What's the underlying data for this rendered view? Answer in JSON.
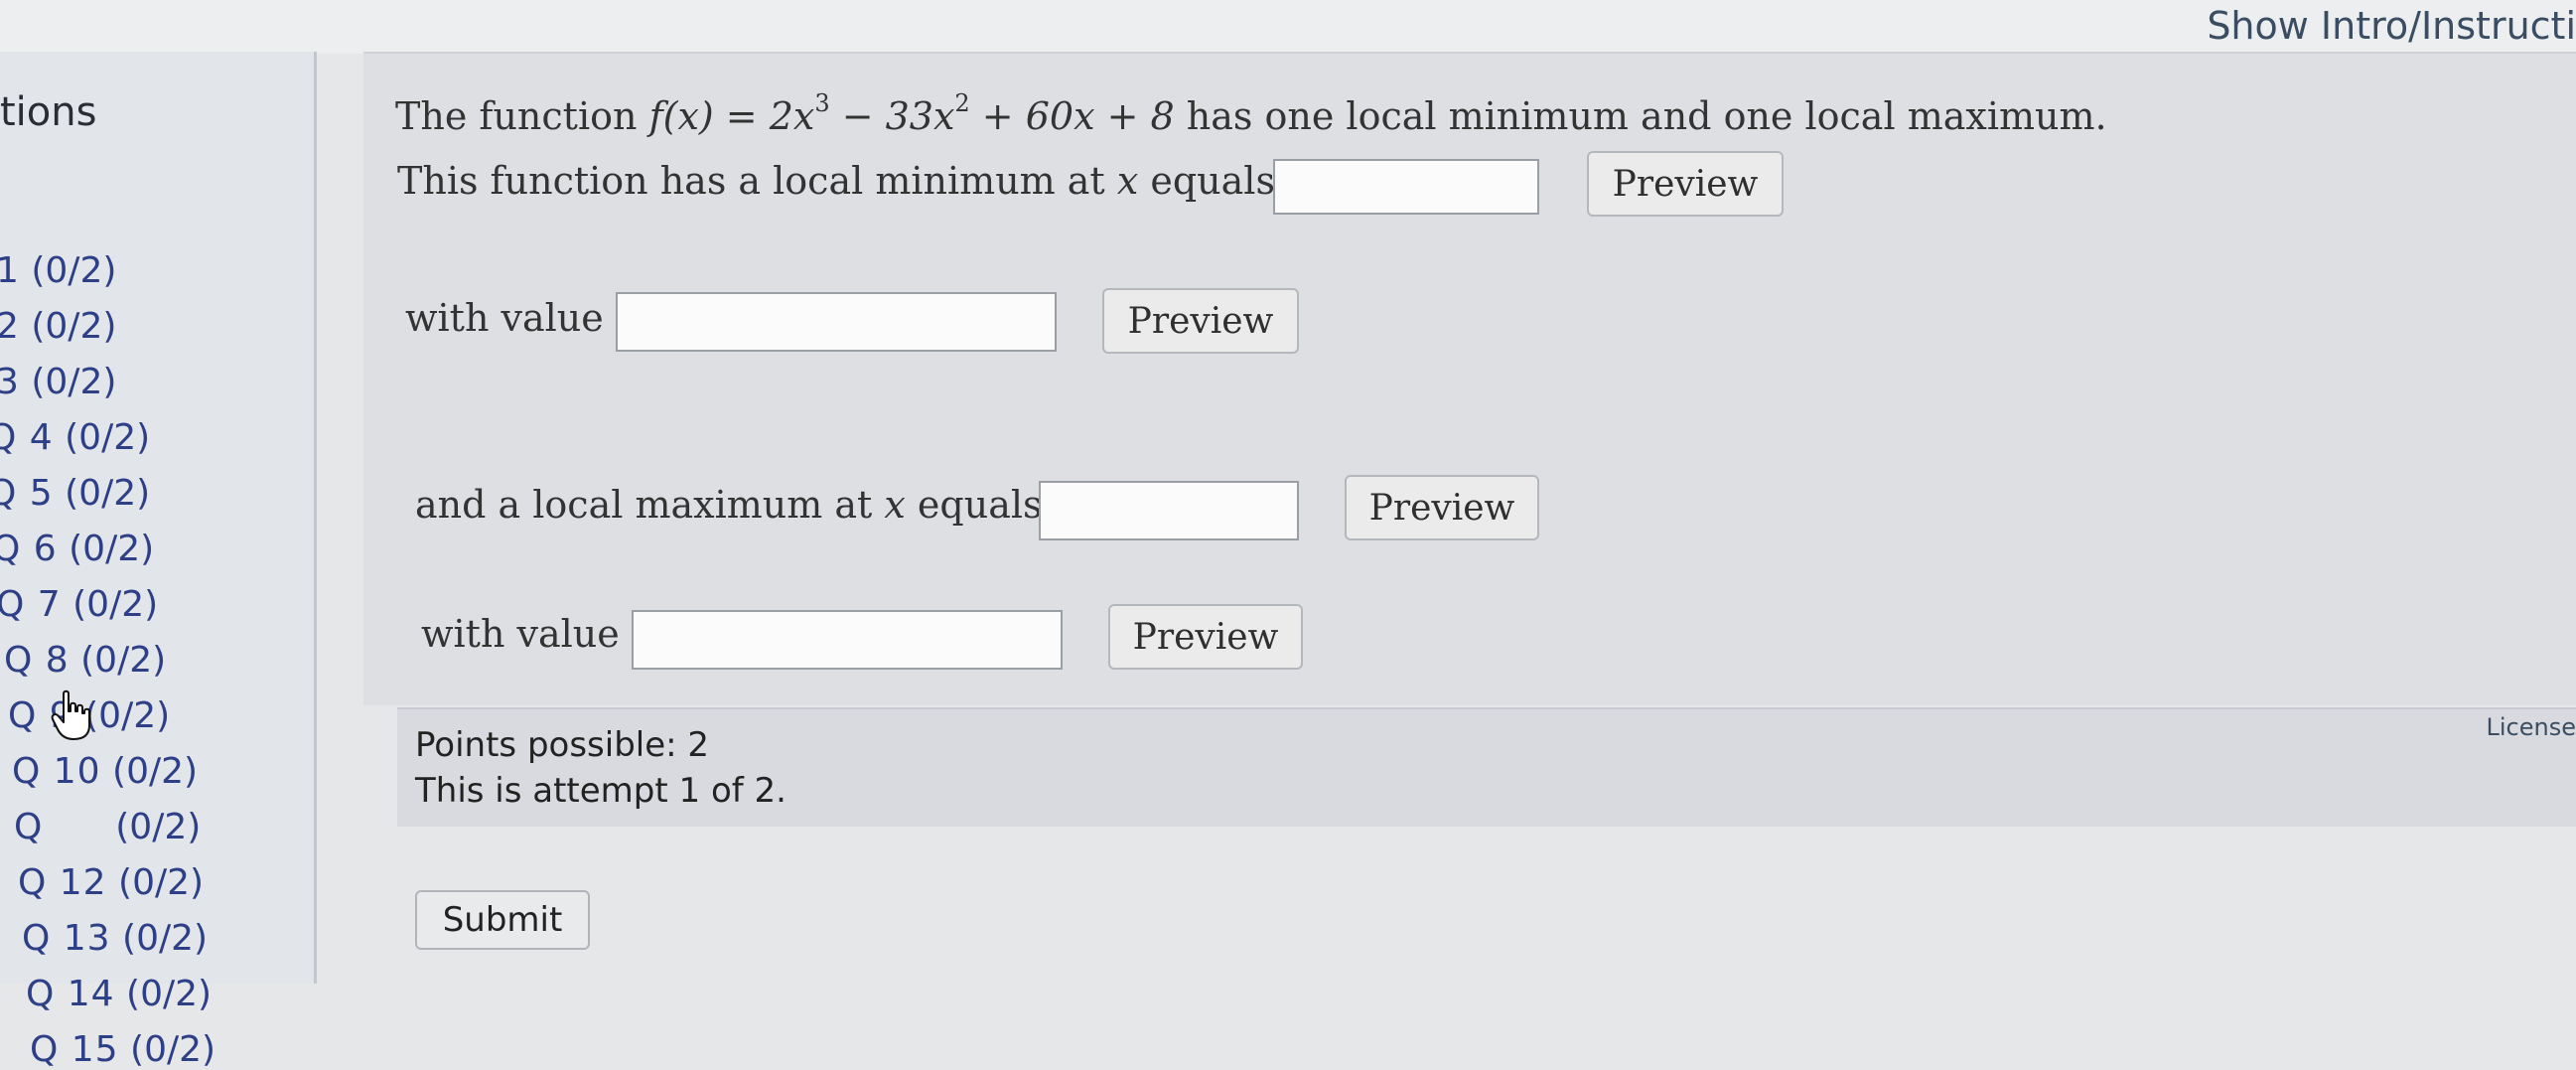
{
  "header": {
    "show_intro_label": "Show Intro/Instructi"
  },
  "sidebar": {
    "title": "tions",
    "items": [
      {
        "label": "1",
        "score": "(0/2)"
      },
      {
        "label": "2",
        "score": "(0/2)"
      },
      {
        "label": "3",
        "score": "(0/2)"
      },
      {
        "label": "Q 4",
        "score": "(0/2)"
      },
      {
        "label": "Q 5",
        "score": "(0/2)"
      },
      {
        "label": "Q 6",
        "score": "(0/2)"
      },
      {
        "label": "Q 7",
        "score": "(0/2)"
      },
      {
        "label": "Q 8",
        "score": "(0/2)"
      },
      {
        "label": "Q 9",
        "score": "(0/2)"
      },
      {
        "label": "Q 10",
        "score": "(0/2)"
      },
      {
        "label": "Q",
        "score": "(0/2)"
      },
      {
        "label": "Q 12",
        "score": "(0/2)"
      },
      {
        "label": "Q 13",
        "score": "(0/2)"
      },
      {
        "label": "Q 14",
        "score": "(0/2)"
      },
      {
        "label": "Q 15",
        "score": "(0/2)"
      }
    ]
  },
  "question": {
    "intro_prefix": "The function",
    "function_name": "f",
    "function_arg": "x",
    "term1": "2x",
    "exp1": "3",
    "term2": "33x",
    "exp2": "2",
    "term3": "+ 60x + 8",
    "intro_suffix": "has one local minimum and one local maximum.",
    "min_x_label": "This function has a local minimum at",
    "min_value_label": "with value",
    "max_x_label": "and a local maximum at",
    "max_value_label": "with value",
    "x_var": "x",
    "equals": "equals",
    "preview_label": "Preview",
    "min_x_value": "",
    "min_value_value": "",
    "max_x_value": "",
    "max_value_value": ""
  },
  "points": {
    "possible": "Points possible: 2",
    "attempt": "This is attempt 1 of 2."
  },
  "license_label": "License",
  "submit_label": "Submit",
  "icons": {
    "cursor": "hand-pointer-icon"
  },
  "colors": {
    "link_blue": "#2d3f86",
    "panel_gray": "#dddfe3"
  }
}
